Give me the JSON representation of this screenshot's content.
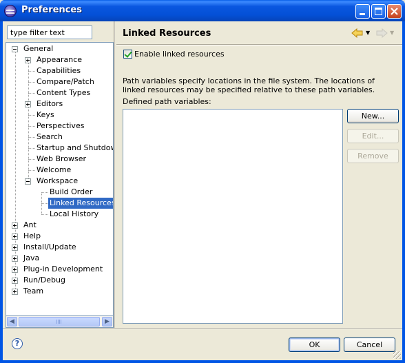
{
  "window": {
    "title": "Preferences",
    "buttons": [
      "minimize",
      "maximize",
      "close"
    ]
  },
  "filter": {
    "placeholder": "type filter text",
    "value": "type filter text"
  },
  "tree": {
    "items": [
      {
        "label": "General",
        "level": 0,
        "toggle": "minus"
      },
      {
        "label": "Appearance",
        "level": 1,
        "toggle": "plus"
      },
      {
        "label": "Capabilities",
        "level": 1,
        "toggle": "none"
      },
      {
        "label": "Compare/Patch",
        "level": 1,
        "toggle": "none"
      },
      {
        "label": "Content Types",
        "level": 1,
        "toggle": "none"
      },
      {
        "label": "Editors",
        "level": 1,
        "toggle": "plus"
      },
      {
        "label": "Keys",
        "level": 1,
        "toggle": "none"
      },
      {
        "label": "Perspectives",
        "level": 1,
        "toggle": "none"
      },
      {
        "label": "Search",
        "level": 1,
        "toggle": "none"
      },
      {
        "label": "Startup and Shutdown",
        "level": 1,
        "toggle": "none"
      },
      {
        "label": "Web Browser",
        "level": 1,
        "toggle": "none"
      },
      {
        "label": "Welcome",
        "level": 1,
        "toggle": "none"
      },
      {
        "label": "Workspace",
        "level": 1,
        "toggle": "minus"
      },
      {
        "label": "Build Order",
        "level": 2,
        "toggle": "none"
      },
      {
        "label": "Linked Resources",
        "level": 2,
        "toggle": "none",
        "selected": true
      },
      {
        "label": "Local History",
        "level": 2,
        "toggle": "none"
      },
      {
        "label": "Ant",
        "level": 0,
        "toggle": "plus"
      },
      {
        "label": "Help",
        "level": 0,
        "toggle": "plus"
      },
      {
        "label": "Install/Update",
        "level": 0,
        "toggle": "plus"
      },
      {
        "label": "Java",
        "level": 0,
        "toggle": "plus"
      },
      {
        "label": "Plug-in Development",
        "level": 0,
        "toggle": "plus"
      },
      {
        "label": "Run/Debug",
        "level": 0,
        "toggle": "plus"
      },
      {
        "label": "Team",
        "level": 0,
        "toggle": "plus"
      }
    ]
  },
  "page": {
    "title": "Linked Resources",
    "enable_checkbox": {
      "label": "Enable linked resources",
      "checked": true
    },
    "description": "Path variables specify locations in the file system. The locations of linked resources may be specified relative to these path variables.",
    "defined_label": "Defined path variables:",
    "buttons": {
      "new": "New...",
      "edit": "Edit...",
      "remove": "Remove"
    }
  },
  "footer": {
    "ok": "OK",
    "cancel": "Cancel",
    "help_icon": "?"
  },
  "colors": {
    "selection": "#316ac5",
    "titlebar": "#0450d6",
    "dialog_bg": "#ece9d8"
  }
}
